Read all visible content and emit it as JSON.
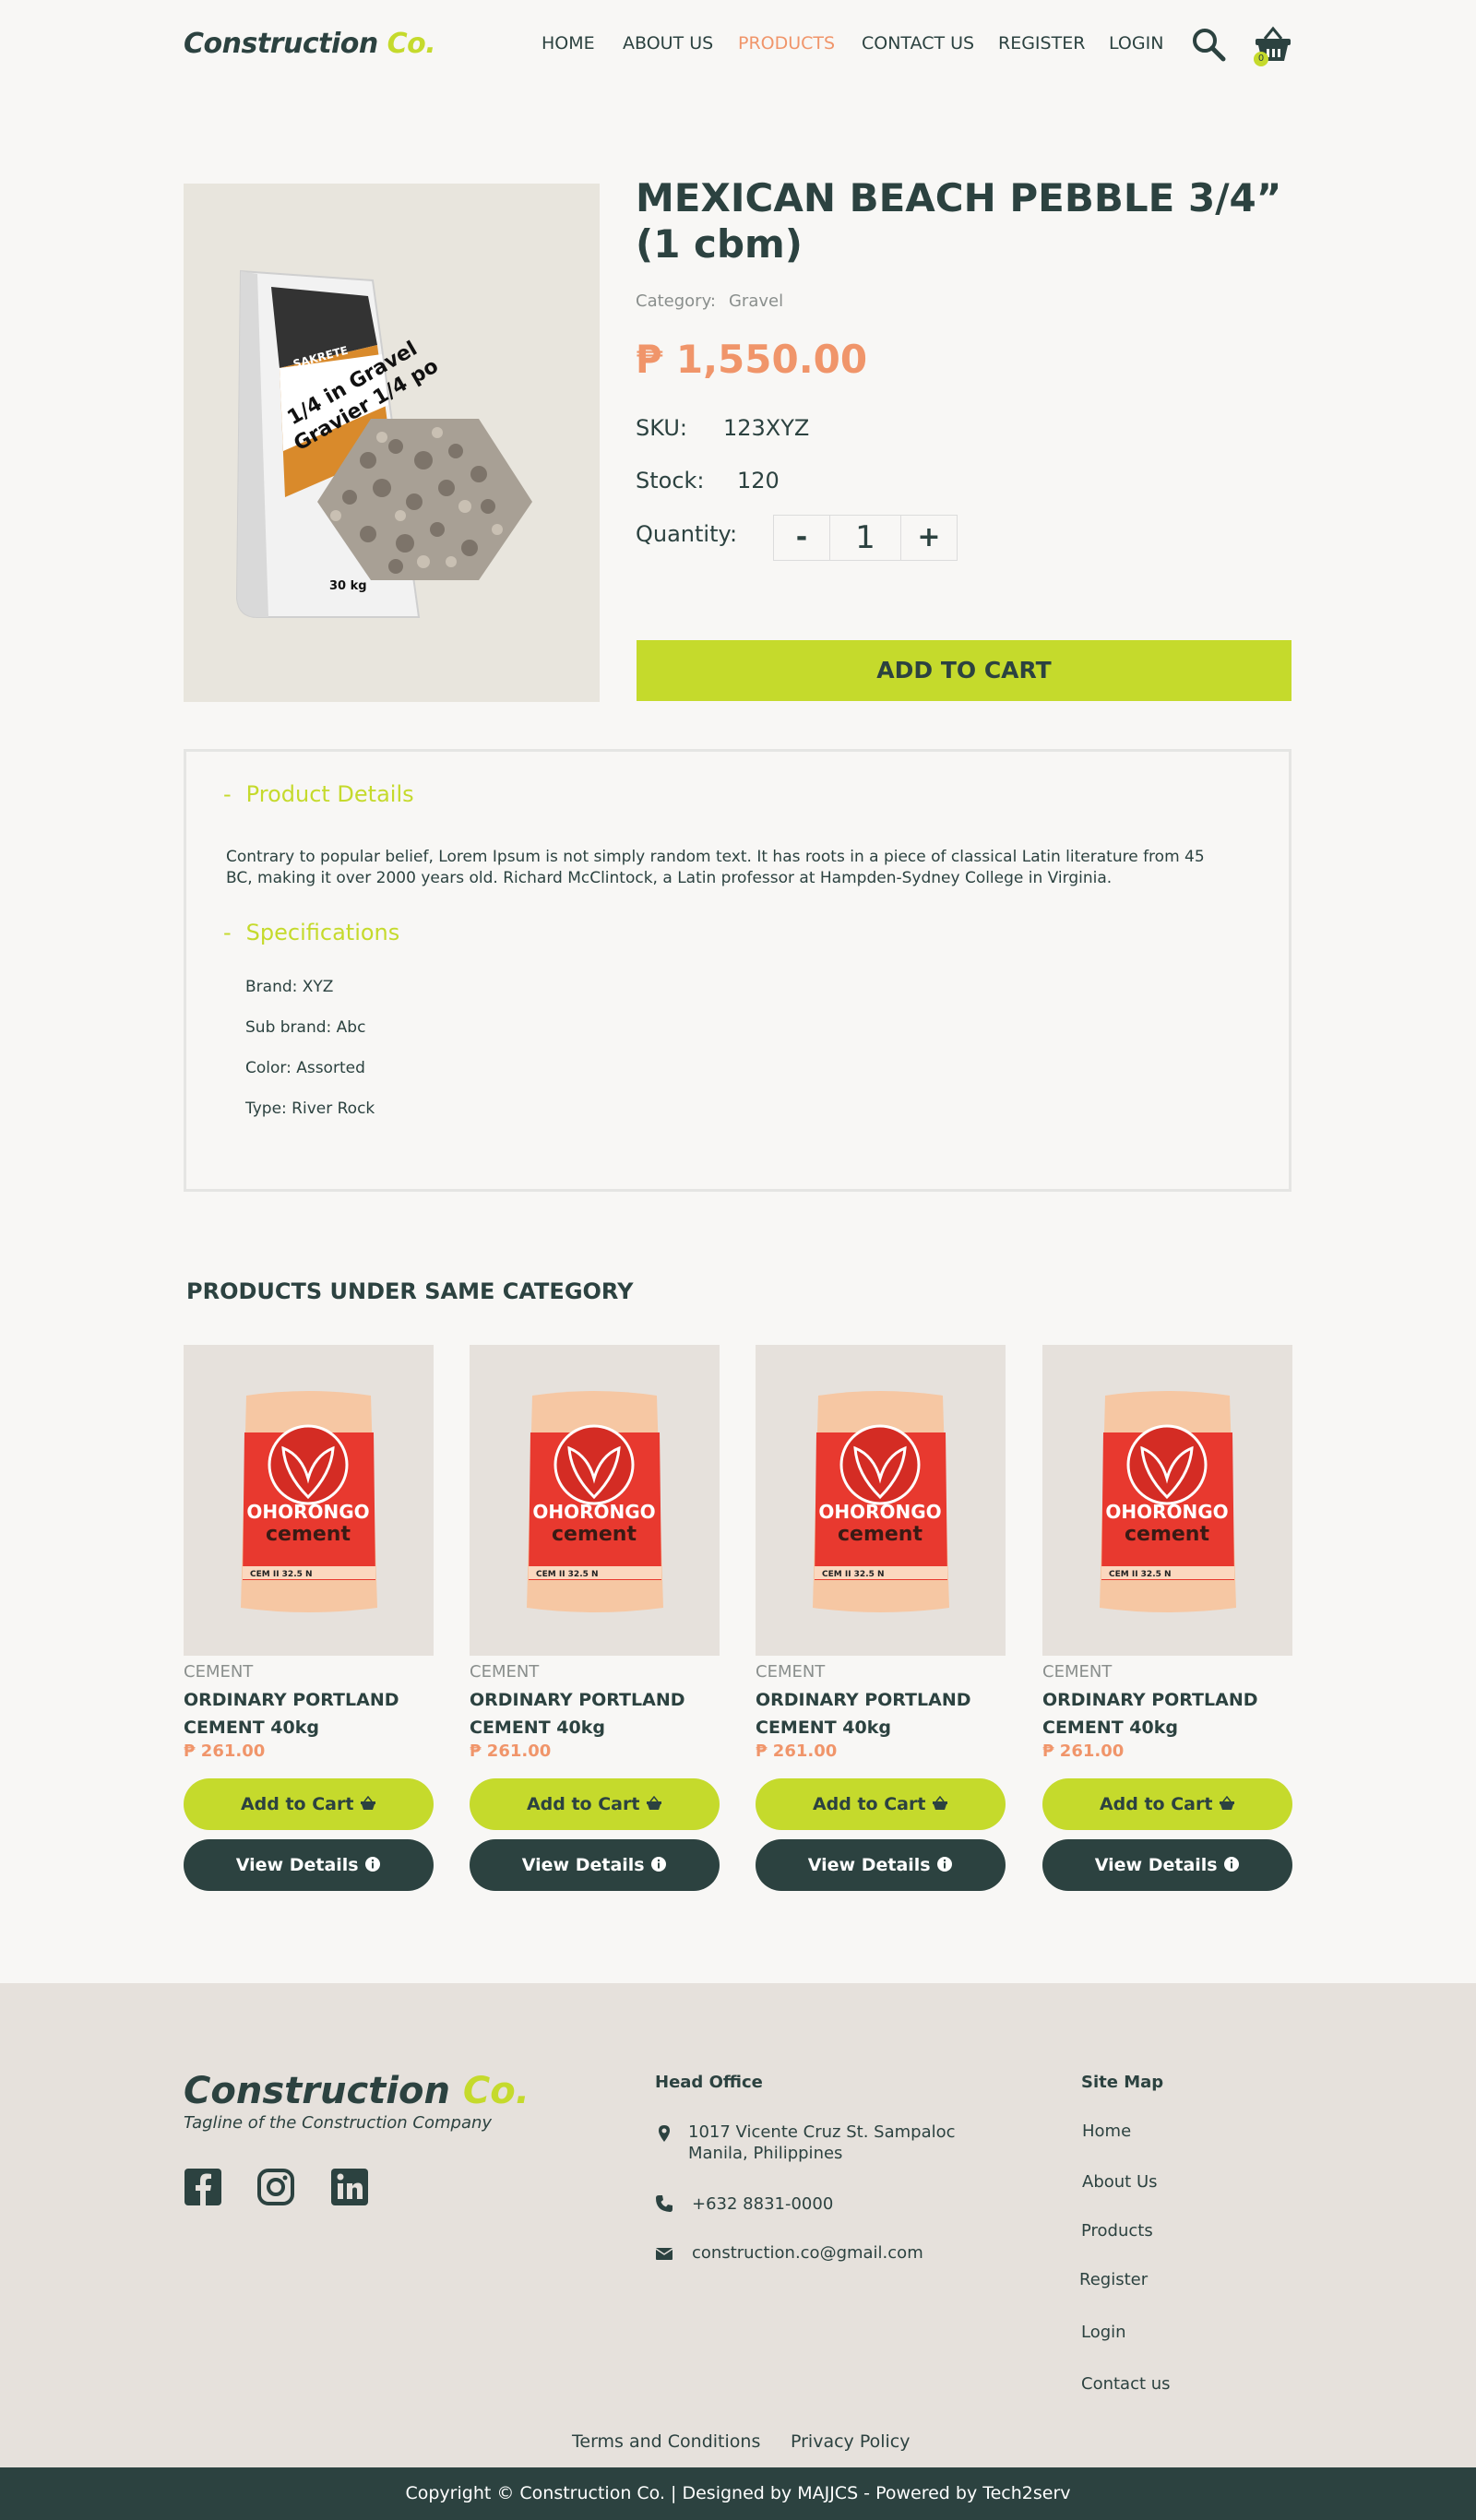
{
  "header": {
    "logo_main": "Construction ",
    "logo_accent": "Co.",
    "nav": [
      "HOME",
      "ABOUT US",
      "PRODUCTS",
      "CONTACT US",
      "REGISTER",
      "LOGIN"
    ],
    "active_nav": "PRODUCTS",
    "cart_count": "0"
  },
  "product": {
    "title": "MEXICAN BEACH PEBBLE 3/4” (1 cbm)",
    "category_label": "Category:",
    "category_value": "Gravel",
    "price": "₱ 1,550.00",
    "sku_label": "SKU:",
    "sku_value": "123XYZ",
    "stock_label": "Stock:",
    "stock_value": "120",
    "quantity_label": "Quantity:",
    "quantity_value": "1",
    "minus": "-",
    "plus": "+",
    "add_to_cart": "ADD TO CART",
    "image_bag_lines": [
      "SAKRETE",
      "1/4 in Gravel",
      "Gravier 1/4 po",
      "30 kg"
    ]
  },
  "details": {
    "product_details_heading": "Product Details",
    "description": "Contrary to popular belief, Lorem Ipsum is not simply random text. It has roots in a piece of classical Latin literature from 45 BC, making it over 2000 years old. Richard McClintock, a Latin professor at Hampden-Sydney College in Virginia.",
    "specifications_heading": "Specifications",
    "specs": [
      "Brand: XYZ",
      "Sub brand: Abc",
      "Color: Assorted",
      "Type: River Rock"
    ],
    "toggle": "-"
  },
  "related": {
    "heading": "PRODUCTS UNDER SAME CATEGORY",
    "items": [
      {
        "category": "CEMENT",
        "name": "ORDINARY PORTLAND CEMENT 40kg",
        "price": "₱ 261.00",
        "add_label": "Add to Cart",
        "view_label": "View Details",
        "bag_brand": "OHORONGO",
        "bag_type": "cement",
        "bag_code": "CEM II 32.5 N"
      },
      {
        "category": "CEMENT",
        "name": "ORDINARY PORTLAND CEMENT 40kg",
        "price": "₱ 261.00",
        "add_label": "Add to Cart",
        "view_label": "View Details",
        "bag_brand": "OHORONGO",
        "bag_type": "cement",
        "bag_code": "CEM II 32.5 N"
      },
      {
        "category": "CEMENT",
        "name": "ORDINARY PORTLAND CEMENT 40kg",
        "price": "₱ 261.00",
        "add_label": "Add to Cart",
        "view_label": "View Details",
        "bag_brand": "OHORONGO",
        "bag_type": "cement",
        "bag_code": "CEM II 32.5 N"
      },
      {
        "category": "CEMENT",
        "name": "ORDINARY PORTLAND CEMENT 40kg",
        "price": "₱ 261.00",
        "add_label": "Add to Cart",
        "view_label": "View Details",
        "bag_brand": "OHORONGO",
        "bag_type": "cement",
        "bag_code": "CEM II 32.5 N"
      }
    ]
  },
  "footer": {
    "logo_main": "Construction ",
    "logo_accent": "Co.",
    "tagline": "Tagline of the Construction Company",
    "head_office_title": "Head Office",
    "address_line1": "1017 Vicente Cruz St. Sampaloc",
    "address_line2": "Manila, Philippines",
    "phone": "+632 8831-0000",
    "email": "construction.co@gmail.com",
    "sitemap_title": "Site Map",
    "sitemap": [
      "Home",
      "About Us",
      "Products",
      "Register",
      "Login",
      "Contact us"
    ],
    "terms": "Terms and Conditions",
    "privacy": "Privacy Policy",
    "copyright": "Copyright © Construction Co.  | Designed by MAJJCS - Powered by Tech2serv"
  },
  "colors": {
    "primary_dark": "#2c4240",
    "accent_lime": "#c5da2c",
    "accent_orange": "#f0956a",
    "bg": "#f8f7f5",
    "footer_bg": "#e6e1dc"
  }
}
